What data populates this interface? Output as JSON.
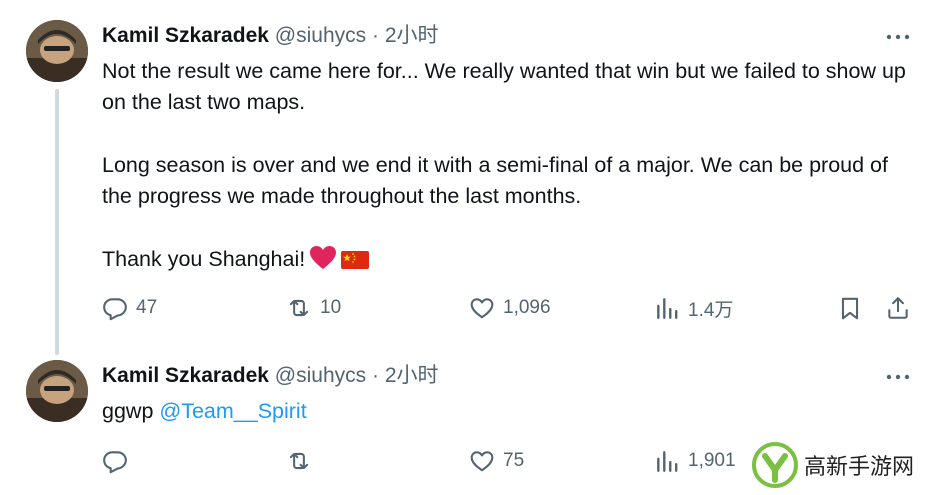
{
  "tweets": [
    {
      "author_name": "Kamil Szkaradek",
      "handle": "@siuhycs",
      "separator": "·",
      "time": "2小时",
      "paragraphs": [
        "Not the result we came here for... We really wanted that win but we failed to show up on the last two maps.",
        "Long season is over and we end it with a semi-final of a major. We can be proud of the progress we made throughout the last months.",
        "Thank you Shanghai!"
      ],
      "emojis": [
        "heart-emoji",
        "china-flag-emoji"
      ],
      "replies": "47",
      "retweets": "10",
      "likes": "1,096",
      "views": "1.4万"
    },
    {
      "author_name": "Kamil Szkaradek",
      "handle": "@siuhycs",
      "separator": "·",
      "time": "2小时",
      "text_prefix": "ggwp ",
      "mention": "@Team__Spirit",
      "replies": "",
      "retweets": "",
      "likes": "75",
      "views": "1,901"
    }
  ],
  "watermark": {
    "text": "高新手游网"
  },
  "colors": {
    "text": "#0f1419",
    "secondary": "#536471",
    "link": "#1d9bf0",
    "line": "#cfd9de",
    "heart": "#e0245e"
  },
  "icons": [
    "reply-icon",
    "retweet-icon",
    "like-icon",
    "views-icon",
    "bookmark-icon",
    "share-icon",
    "more-icon"
  ]
}
